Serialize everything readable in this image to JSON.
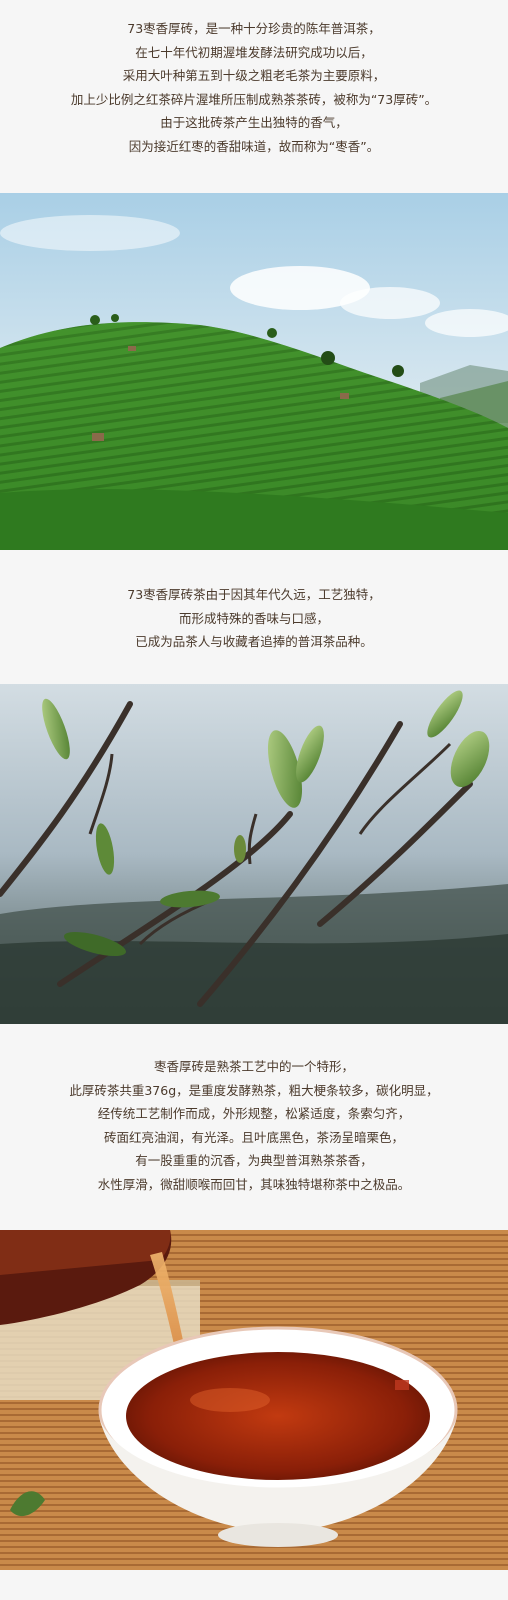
{
  "intro": {
    "lines": [
      "73枣香厚砖，是一种十分珍贵的陈年普洱茶，",
      "在七十年代初期渥堆发酵法研究成功以后，",
      "采用大叶种第五到十级之粗老毛茶为主要原料，",
      "加上少比例之红茶碎片渥堆所压制成熟茶茶砖，被称为“73厚砖”。",
      "由于这批砖茶产生出独特的香气，",
      "因为接近红枣的香甜味道，故而称为“枣香”。"
    ]
  },
  "history": {
    "lines": [
      "73枣香厚砖茶由于因其年代久远，工艺独特，",
      "而形成特殊的香味与口感，",
      "已成为品茶人与收藏者追捧的普洱茶品种。"
    ]
  },
  "description": {
    "lines": [
      "枣香厚砖是熟茶工艺中的一个特形，",
      "此厚砖茶共重376g，是重度发酵熟茶，粗大梗条较多，碳化明显，",
      "经传统工艺制作而成，外形规整，松紧适度，条索匀齐，",
      "砖面红亮油润，有光泽。且叶底黑色，茶汤呈暗栗色，",
      "有一股重重的沉香，为典型普洱熟茶茶香，",
      "水性厚滑，微甜顺喉而回甘，其味独特堪称茶中之极品。"
    ]
  },
  "colors": {
    "text": "#4b3a2c",
    "background": "#f6f6f6",
    "tea_green": "#3f8f2a",
    "tea_soup": "#8a1f08"
  }
}
